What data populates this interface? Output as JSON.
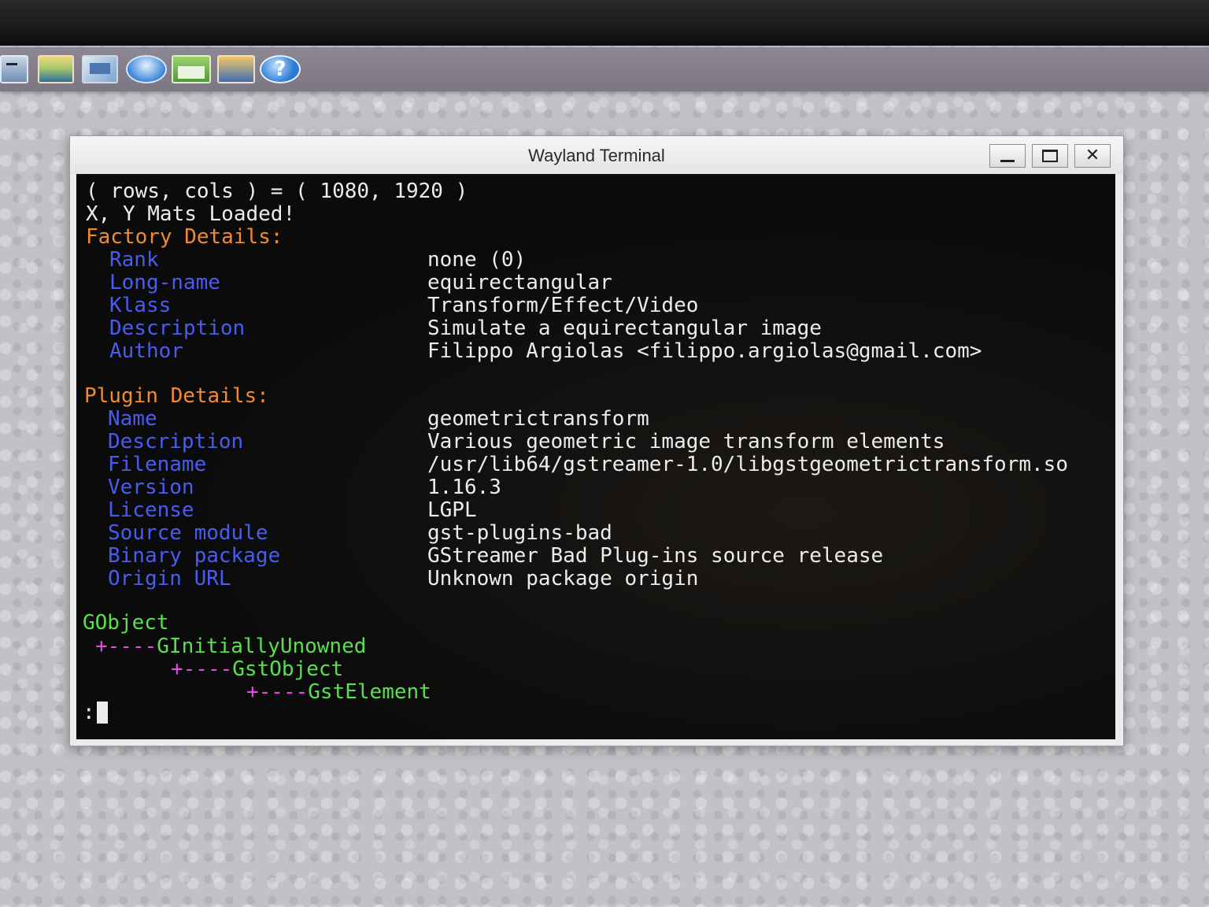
{
  "panel": {
    "launchers": [
      "terminal-icon",
      "image-viewer-icon",
      "screenshot-icon",
      "browser-icon",
      "window-icon",
      "network-icon",
      "help-icon"
    ],
    "help_glyph": "?"
  },
  "window": {
    "title": "Wayland Terminal",
    "minimize_glyph": "_",
    "close_glyph": "✕"
  },
  "terminal": {
    "line1": "( rows, cols ) = ( 1080, 1920 )",
    "line2": "X, Y Mats Loaded!",
    "factory_heading": "Factory Details:",
    "factory": [
      {
        "key": "Rank",
        "value": "none (0)"
      },
      {
        "key": "Long-name",
        "value": "equirectangular"
      },
      {
        "key": "Klass",
        "value": "Transform/Effect/Video"
      },
      {
        "key": "Description",
        "value": "Simulate a equirectangular image"
      },
      {
        "key": "Author",
        "value": "Filippo Argiolas <filippo.argiolas@gmail.com>"
      }
    ],
    "plugin_heading": "Plugin Details:",
    "plugin": [
      {
        "key": "Name",
        "value": "geometrictransform"
      },
      {
        "key": "Description",
        "value": "Various geometric image transform elements"
      },
      {
        "key": "Filename",
        "value": "/usr/lib64/gstreamer-1.0/libgstgeometrictransform.so"
      },
      {
        "key": "Version",
        "value": "1.16.3"
      },
      {
        "key": "License",
        "value": "LGPL"
      },
      {
        "key": "Source module",
        "value": "gst-plugins-bad"
      },
      {
        "key": "Binary package",
        "value": "GStreamer Bad Plug-ins source release"
      },
      {
        "key": "Origin URL",
        "value": "Unknown package origin"
      }
    ],
    "hierarchy": {
      "root": "GObject",
      "connector": "+----",
      "level1": "GInitiallyUnowned",
      "level2": "GstObject",
      "level3": "GstElement"
    },
    "prompt": ":"
  },
  "colors": {
    "heading": "#f28a2e",
    "key": "#4a5cf0",
    "text": "#ececec",
    "tree": "#58e04e",
    "connector": "#e64ae6",
    "terminal_bg": "#0b0b0b"
  }
}
